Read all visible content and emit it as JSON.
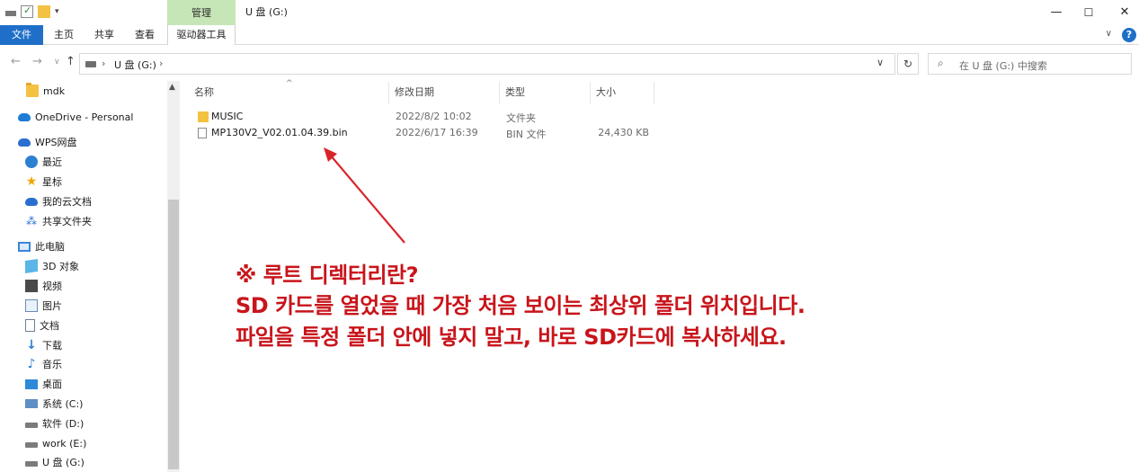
{
  "window": {
    "title": "U 盘 (G:)",
    "context_tab_group": "管理",
    "controls": {
      "minimize": "—",
      "maximize": "☐",
      "close": "✕"
    }
  },
  "ribbon": {
    "tabs": [
      "文件",
      "主页",
      "共享",
      "查看",
      "驱动器工具"
    ],
    "help": "?"
  },
  "address": {
    "path": "U 盘 (G:)",
    "search_placeholder": "在 U 盘 (G:) 中搜索"
  },
  "sidebar": {
    "items": [
      {
        "label": "mdk",
        "icon": "folder-icon"
      },
      {
        "label": "OneDrive - Personal",
        "icon": "onedrive-icon"
      },
      {
        "label": "WPS网盘",
        "icon": "wps-cloud-icon"
      },
      {
        "label": "最近",
        "icon": "recent-icon"
      },
      {
        "label": "星标",
        "icon": "star-icon"
      },
      {
        "label": "我的云文档",
        "icon": "cloud-docs-icon"
      },
      {
        "label": "共享文件夹",
        "icon": "shared-folder-icon"
      },
      {
        "label": "此电脑",
        "icon": "this-pc-icon"
      },
      {
        "label": "3D 对象",
        "icon": "3d-objects-icon"
      },
      {
        "label": "视频",
        "icon": "video-icon"
      },
      {
        "label": "图片",
        "icon": "pictures-icon"
      },
      {
        "label": "文档",
        "icon": "documents-icon"
      },
      {
        "label": "下载",
        "icon": "downloads-icon"
      },
      {
        "label": "音乐",
        "icon": "music-icon"
      },
      {
        "label": "桌面",
        "icon": "desktop-icon"
      },
      {
        "label": "系统 (C:)",
        "icon": "system-drive-icon"
      },
      {
        "label": "软件 (D:)",
        "icon": "drive-icon"
      },
      {
        "label": "work (E:)",
        "icon": "drive-icon"
      },
      {
        "label": "U 盘 (G:)",
        "icon": "usb-drive-icon"
      }
    ]
  },
  "filelist": {
    "columns": [
      "名称",
      "修改日期",
      "类型",
      "大小"
    ],
    "rows": [
      {
        "name": "MUSIC",
        "date": "2022/8/2 10:02",
        "type": "文件夹",
        "size": ""
      },
      {
        "name": "MP130V2_V02.01.04.39.bin",
        "date": "2022/6/17 16:39",
        "type": "BIN 文件",
        "size": "24,430 KB"
      }
    ]
  },
  "annotation": {
    "lines": [
      "※ 루트 디렉터리란?",
      "SD 카드를 열었을 때 가장 처음 보이는 최상위 폴더 위치입니다.",
      "파일을 특정 폴더 안에 넣지 말고, 바로 SD카드에 복사하세요."
    ],
    "color": "#c8151b"
  }
}
